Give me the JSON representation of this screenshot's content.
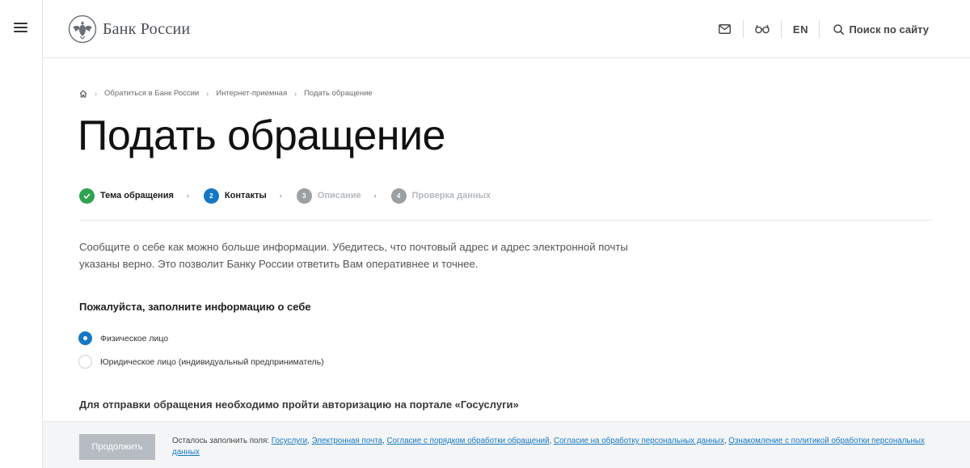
{
  "header": {
    "logo_text": "Банк России",
    "lang": "EN",
    "search_label": "Поиск по сайту"
  },
  "breadcrumb": [
    "Обратиться в Банк России",
    "Интернет-приемная",
    "Подать обращение"
  ],
  "page_title": "Подать обращение",
  "steps": [
    {
      "number": "✓",
      "label": "Тема обращения",
      "state": "done"
    },
    {
      "number": "2",
      "label": "Контакты",
      "state": "active"
    },
    {
      "number": "3",
      "label": "Описание",
      "state": "pending"
    },
    {
      "number": "4",
      "label": "Проверка данных",
      "state": "pending"
    }
  ],
  "intro_text": "Сообщите о себе как можно больше информации. Убедитесь, что почтовый адрес и адрес электронной почты указаны верно. Это позволит Банку России ответить Вам оперативнее и точнее.",
  "form": {
    "section_title": "Пожалуйста, заполните информацию о себе",
    "options": [
      {
        "label": "Физическое лицо",
        "checked": true
      },
      {
        "label": "Юридическое лицо (индивидуальный предприниматель)",
        "checked": false
      }
    ],
    "auth_note": "Для отправки обращения необходимо пройти авторизацию на портале «Госуслуги»"
  },
  "footer": {
    "continue_label": "Продолжить",
    "remaining_prefix": "Осталось заполнить поля:",
    "remaining_fields": [
      "Госуслуги",
      "Электронная почта",
      "Согласие с порядком обработки обращений",
      "Согласие на обработку персональных данных",
      "Ознакомление с политикой обработки персональных данных"
    ]
  },
  "colors": {
    "accent": "#1479c4",
    "done": "#2ea44f",
    "pending": "#9aa0a6",
    "disabled_button": "#b7bcc2"
  }
}
